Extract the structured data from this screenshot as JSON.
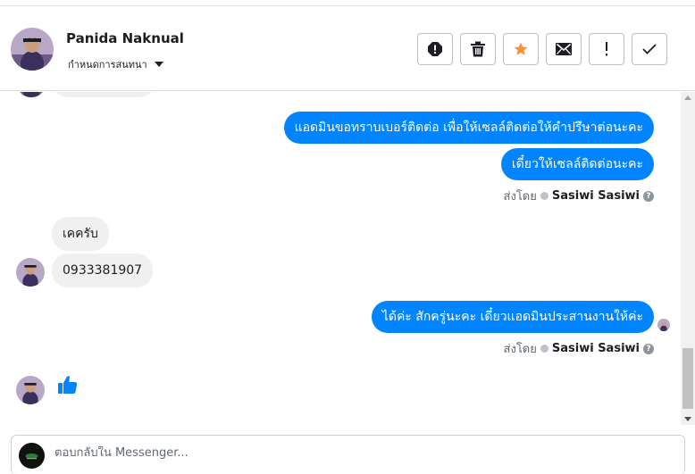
{
  "header": {
    "contact_name": "Panida Naknual",
    "assign_label": "กำหนดการสนทนา",
    "actions": [
      {
        "name": "spam-button",
        "icon": "alert-circle-icon"
      },
      {
        "name": "delete-button",
        "icon": "trash-icon"
      },
      {
        "name": "star-button",
        "icon": "star-icon"
      },
      {
        "name": "mark-unread-button",
        "icon": "envelope-icon"
      },
      {
        "name": "follow-up-button",
        "icon": "exclamation-icon"
      },
      {
        "name": "mark-done-button",
        "icon": "check-icon"
      }
    ]
  },
  "conversation": {
    "messages_out_1": [
      "แอดมินขอทราบเบอร์ติดต่อ เพื่อให้เซลล์ติดต่อให้คำปรึษาต่อนะคะ",
      "เดี๋ยวให้เซลล์ติดต่อนะคะ"
    ],
    "messages_in": [
      "เคครับ",
      "0933381907"
    ],
    "messages_out_2": [
      "ได้ค่ะ สักครู่นะคะ เดี๋ยวแอดมินประสานงานให้ค่ะ"
    ],
    "sent_by_label": "ส่งโดย",
    "sent_by_name": "Sasiwi Sasiwi",
    "last_in_sticker": "thumbs-up-icon"
  },
  "reply": {
    "placeholder": "ตอบกลับใน Messenger..."
  },
  "colors": {
    "outgoing_bubble": "#0084ff",
    "incoming_bubble": "#f0f0f0",
    "star": "#f7923b",
    "like": "#0084ff"
  }
}
